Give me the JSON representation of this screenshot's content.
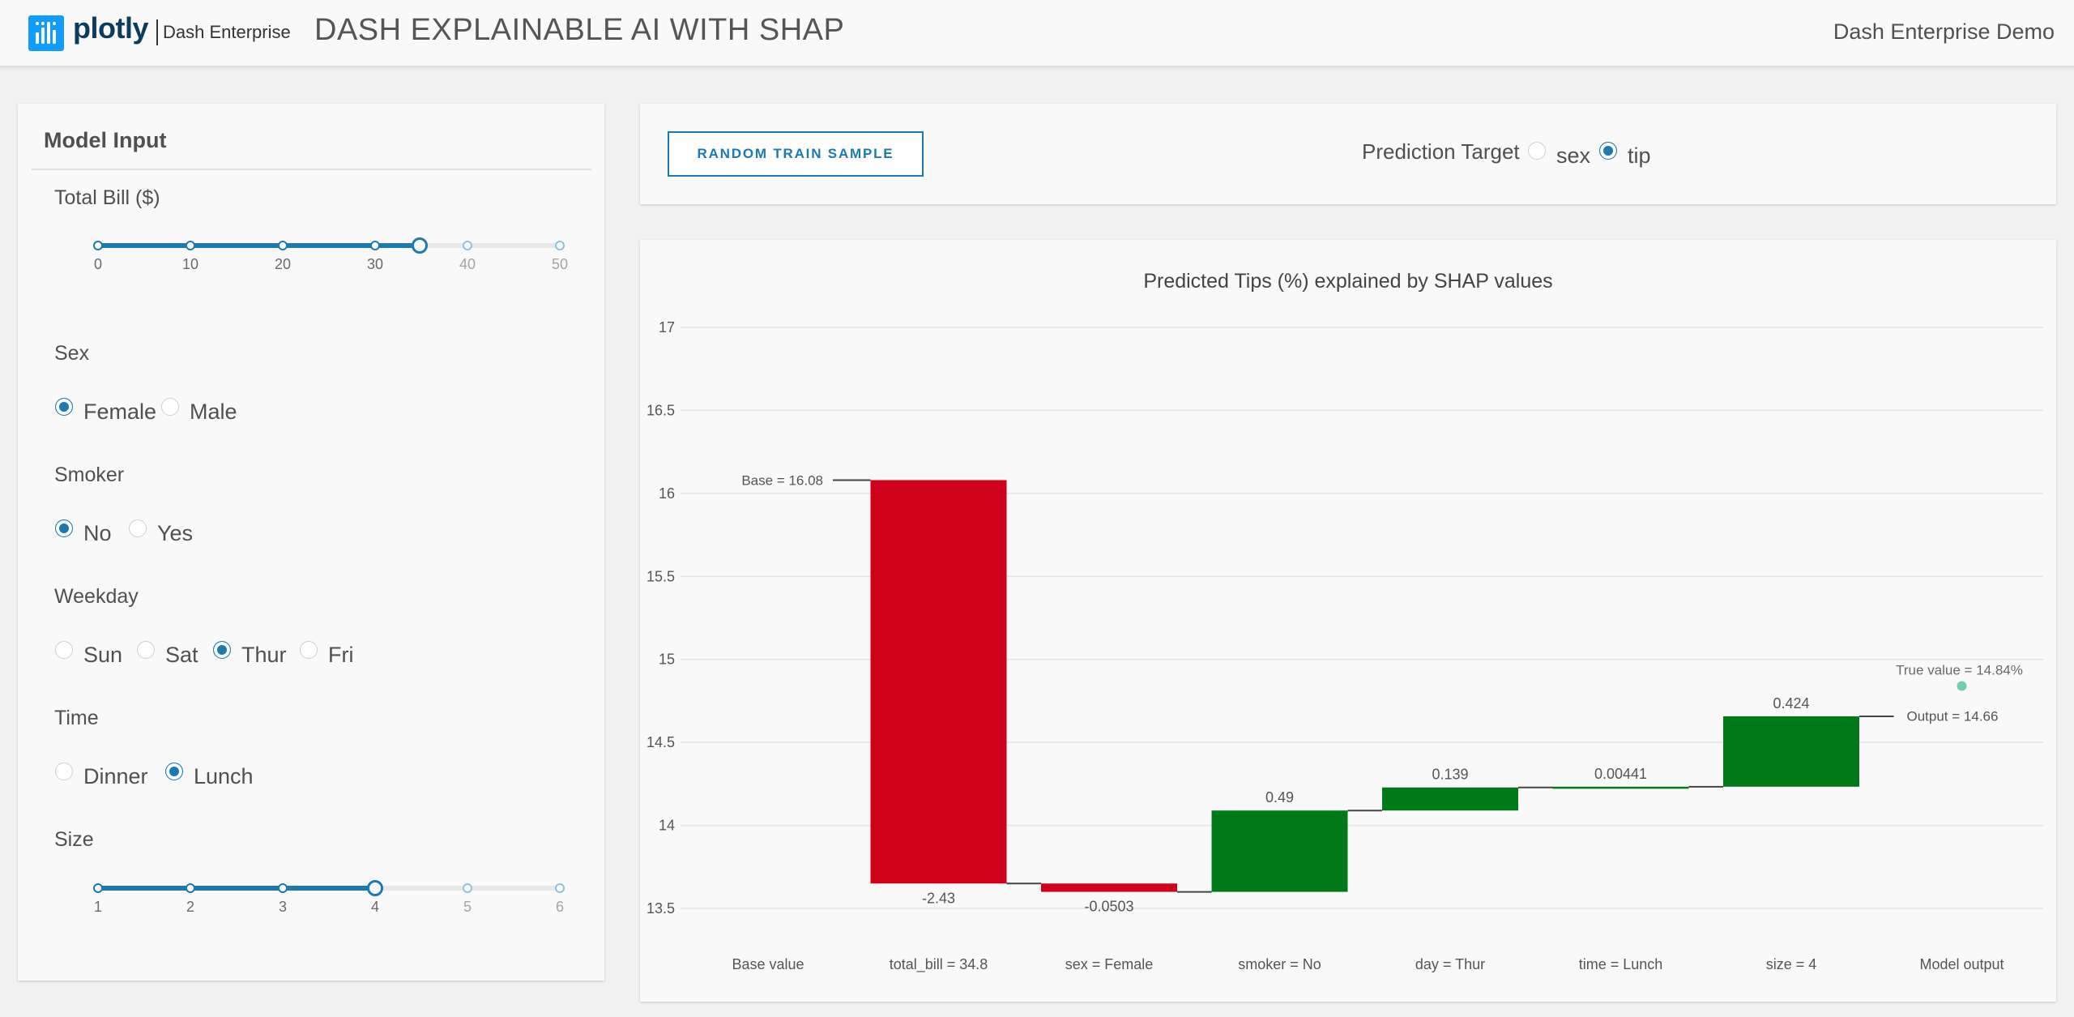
{
  "header": {
    "brand": "plotly",
    "brand_sub": "Dash Enterprise",
    "title": "DASH EXPLAINABLE AI WITH SHAP",
    "right_label": "Dash Enterprise Demo"
  },
  "model_input": {
    "title": "Model Input",
    "total_bill": {
      "label": "Total Bill ($)",
      "value": 34.8,
      "min": 0,
      "max": 50,
      "ticks": [
        "0",
        "10",
        "20",
        "30",
        "40",
        "50"
      ]
    },
    "sex": {
      "label": "Sex",
      "options": [
        "Female",
        "Male"
      ],
      "selected": "Female"
    },
    "smoker": {
      "label": "Smoker",
      "options": [
        "No",
        "Yes"
      ],
      "selected": "No"
    },
    "weekday": {
      "label": "Weekday",
      "options": [
        "Sun",
        "Sat",
        "Thur",
        "Fri"
      ],
      "selected": "Thur"
    },
    "time": {
      "label": "Time",
      "options": [
        "Dinner",
        "Lunch"
      ],
      "selected": "Lunch"
    },
    "size": {
      "label": "Size",
      "value": 4,
      "min": 1,
      "max": 6,
      "ticks": [
        "1",
        "2",
        "3",
        "4",
        "5",
        "6"
      ]
    }
  },
  "controls": {
    "random_button": "RANDOM TRAIN SAMPLE",
    "prediction_target_label": "Prediction Target",
    "prediction_target_options": [
      "sex",
      "tip"
    ],
    "prediction_target_selected": "tip"
  },
  "colors": {
    "accent": "#1b7aaf",
    "negative": "#d0021b",
    "positive": "#007a18",
    "true_value_marker": "#6fcfae"
  },
  "chart_data": {
    "type": "bar",
    "subtype": "waterfall",
    "title": "Predicted Tips (%) explained by SHAP values",
    "categories": [
      "Base value",
      "total_bill = 34.8",
      "sex = Female",
      "smoker = No",
      "day = Thur",
      "time = Lunch",
      "size = 4",
      "Model output"
    ],
    "base": 16.08,
    "base_label": "Base = 16.08",
    "contributions": [
      {
        "category": "total_bill = 34.8",
        "value": -2.43,
        "label": "-2.43"
      },
      {
        "category": "sex = Female",
        "value": -0.0503,
        "label": "-0.0503"
      },
      {
        "category": "smoker = No",
        "value": 0.49,
        "label": "0.49"
      },
      {
        "category": "day = Thur",
        "value": 0.139,
        "label": "0.139"
      },
      {
        "category": "time = Lunch",
        "value": 0.00441,
        "label": "0.00441"
      },
      {
        "category": "size = 4",
        "value": 0.424,
        "label": "0.424"
      }
    ],
    "output": 14.66,
    "output_label": "Output = 14.66",
    "true_value": 14.84,
    "true_value_label": "True value = 14.84%",
    "ylim": [
      13.4,
      17.2
    ],
    "yticks": [
      13.5,
      14,
      14.5,
      15,
      15.5,
      16,
      16.5,
      17
    ],
    "ytick_labels": [
      "13.5",
      "14",
      "14.5",
      "15",
      "15.5",
      "16",
      "16.5",
      "17"
    ],
    "grid": true,
    "xlabel": "",
    "ylabel": ""
  }
}
